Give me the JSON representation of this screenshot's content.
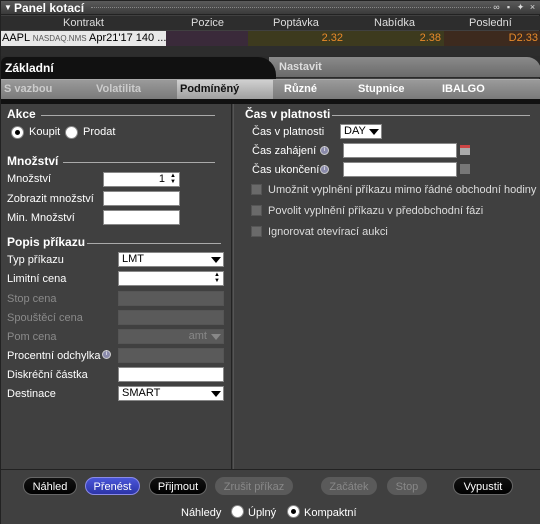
{
  "window": {
    "title": "Panel kotací"
  },
  "quote": {
    "headers": {
      "contract": "Kontrakt",
      "position": "Pozice",
      "bid": "Poptávka",
      "ask": "Nabídka",
      "last": "Poslední"
    },
    "row": {
      "symbol": "AAPL",
      "exchange": "NASDAQ.NMS",
      "contract_rest": "Apr21'17 140 ...",
      "position": "",
      "bid": "2.32",
      "ask": "2.38",
      "last": "D2.33"
    }
  },
  "tabs": {
    "top": [
      {
        "label": "Základní"
      },
      {
        "label": "Nastavit"
      }
    ],
    "second": [
      {
        "label": "S vazbou"
      },
      {
        "label": "Volatilita"
      },
      {
        "label": "Podmíněný"
      },
      {
        "label": "Různé"
      },
      {
        "label": "Stupnice"
      },
      {
        "label": "IBALGO"
      }
    ]
  },
  "action": {
    "title": "Akce",
    "buy": "Koupit",
    "sell": "Prodat",
    "selected": "buy"
  },
  "quantity": {
    "title": "Množství",
    "qty_label": "Množství",
    "qty_value": "1",
    "display_label": "Zobrazit množství",
    "display_value": "",
    "min_label": "Min. Množství",
    "min_value": ""
  },
  "order": {
    "title": "Popis příkazu",
    "type_label": "Typ příkazu",
    "type_value": "LMT",
    "limit_label": "Limitní cena",
    "limit_value": "",
    "stop_label": "Stop cena",
    "trigger_label": "Spouštěcí cena",
    "aux_label": "Pom cena",
    "aux_value": "amt",
    "pct_label": "Procentní odchylka",
    "disc_label": "Diskréční částka",
    "disc_value": "",
    "dest_label": "Destinace",
    "dest_value": "SMART"
  },
  "validity": {
    "title": "Čas v platnosti",
    "tif_label": "Čas v platnosti",
    "tif_value": "DAY",
    "start_label": "Čas zahájení",
    "start_value": "",
    "end_label": "Čas ukončení",
    "end_value": "",
    "opt_outside_rth": "Umožnit vyplnění příkazu mimo řádné obchodní hodiny",
    "opt_premarket": "Povolit vyplnění příkazu v předobchodní fázi",
    "opt_ignore_open": "Ignorovat otevírací aukci"
  },
  "buttons": {
    "preview": "Náhled",
    "transmit": "Přenést",
    "accept": "Přijmout",
    "cancel_order": "Zrušit příkaz",
    "start": "Začátek",
    "stop": "Stop",
    "release": "Vypustit"
  },
  "previews": {
    "label": "Náhledy",
    "full": "Úplný",
    "compact": "Kompaktní",
    "selected": "compact"
  },
  "colors": {
    "accent_blue": "#3a44c8",
    "price_orange": "#e88a2a"
  }
}
